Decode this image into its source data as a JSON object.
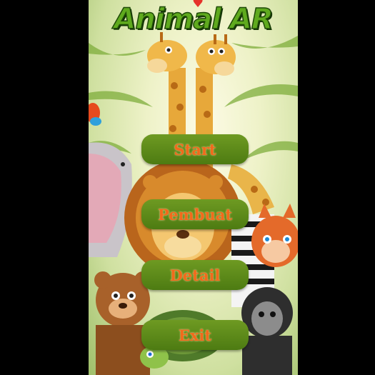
{
  "app": {
    "title": "Animal AR"
  },
  "menu": {
    "start_label": "Start",
    "pembuat_label": "Pembuat",
    "detail_label": "Detail",
    "exit_label": "Exit"
  },
  "colors": {
    "button_bg": "#5a8a19",
    "button_text": "#f26a1b",
    "title_green": "#5faa1e",
    "title_outline": "#1f4a08"
  },
  "icons": [
    "heart-icon",
    "giraffe-illustration",
    "lion-illustration",
    "elephant-illustration",
    "bear-illustration",
    "monkey-illustration",
    "fox-illustration",
    "turtle-illustration",
    "zebra-illustration",
    "bird-illustration"
  ]
}
